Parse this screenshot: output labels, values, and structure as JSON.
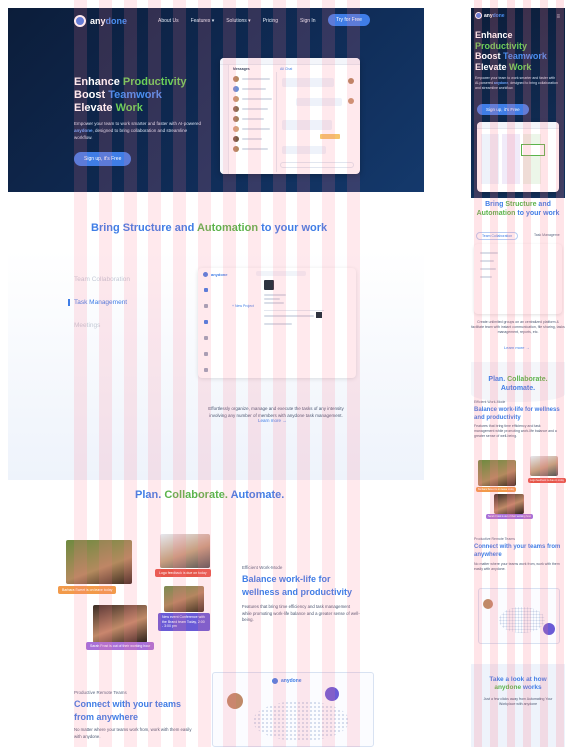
{
  "brand": {
    "name_prefix": "any",
    "name_suffix": "done"
  },
  "nav": {
    "items": [
      "About Us",
      "Features",
      "Solutions",
      "Pricing"
    ],
    "sign_in": "Sign In",
    "try_free": "Try for Free"
  },
  "hero": {
    "title_line1_a": "Enhance ",
    "title_line1_b": "Productivity",
    "title_line2_a": "Boost ",
    "title_line2_b": "Teamwork",
    "title_line3_a": "Elevate ",
    "title_line3_b": "Work",
    "subtitle_a": "Empower your team to work smarter and faster with AI-powered ",
    "subtitle_brand": "anydone",
    "subtitle_b": ", designed to bring collaboration and streamline workflow.",
    "cta": "Sign up, it's Free",
    "mock_title": "Messages",
    "mock_all": "All Chat"
  },
  "structure": {
    "title_a": "Bring ",
    "title_b": "Structure",
    "title_c": " and ",
    "title_d": "Automation",
    "title_e": " to your work",
    "tabs": [
      "Team Collaboration",
      "Task Management",
      "Meetings"
    ],
    "active_tab": "Task Management",
    "new_project": "+ New Project",
    "description": "Effortlessly organize, manage and execute the tasks of any intensity involving any number of members with anydone task management.",
    "learn_more": "Learn more →"
  },
  "plan": {
    "title_a": "Plan. ",
    "title_b": "Collaborate. ",
    "title_c": "Automate.",
    "pill_1": "Barbara Sweet is on leave today",
    "pill_2": "Logo feedback is due on today",
    "pill_3": "Sarah Frost is out of their working hour",
    "event": "New event Conference with the Brand team Today, 2:00 - 3:00 pm",
    "efficient_label": "Efficient Work-Mode",
    "efficient_head": "Balance work-life for wellness and productivity",
    "efficient_text": "Features that bring time efficiency and task management while promoting work-life balance and a greater sense of well-being."
  },
  "remote": {
    "label": "Productive Remote Teams",
    "head": "Connect with your teams from anywhere",
    "text": "No matter where your teams work from, work with them easily with anydone."
  },
  "mobile": {
    "title_line1_a": "Enhance",
    "title_line2_b": "Productivity",
    "title_line3_a": "Boost ",
    "title_line3_b": "Teamwork",
    "title_line4_a": "Elevate ",
    "title_line4_b": "Work",
    "subtitle_a": "Empower your team to work smarter and faster with AI-powered ",
    "subtitle_brand": "anydone",
    "subtitle_b": ", designed to bring collaboration and streamline workflow.",
    "cta": "Sign up, it's Free",
    "bring_a": "Bring ",
    "bring_b": "Structure",
    "bring_c": " and",
    "bring_d": "Automation",
    "bring_e": " to your work",
    "tab_1": "Team Collaboration",
    "tab_2": "Task Manageme",
    "collab_text": "Create unlimited groups on an centralized platform & facilitate team with instant communication, file sharing, tasks management, reports, etc.",
    "learn_more": "Learn more →",
    "plan_a": "Plan. ",
    "plan_b": "Collaborate.",
    "plan_c": "Automate.",
    "eff_label": "Efficient Work-Mode",
    "eff_head": "Balance work-life for wellness and productivity",
    "eff_text": "Features that bring time efficiency and task management while promoting work-life balance and a greater sense of well-being.",
    "remote_label": "Productive Remote Teams",
    "remote_head": "Connect with your teams from anywhere",
    "remote_text": "No matter where your teams work from, work with them easily with anydone.",
    "look_a": "Take a look at how",
    "look_b": "anydone",
    "look_c": " works",
    "look_text": "Just a few clicks away from Automating Your Workplace with anydone"
  },
  "colors": {
    "primary": "#3f7de6",
    "green": "#5bb44b",
    "navy": "#0f2b55"
  }
}
